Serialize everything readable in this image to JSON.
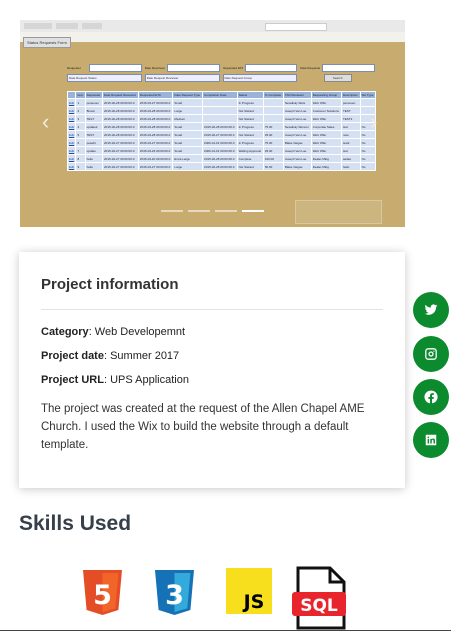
{
  "carousel": {
    "slide": {
      "app_button": "Status Requests Form",
      "filters": {
        "row1": [
          {
            "label": "Requester",
            "value": ""
          },
          {
            "label": "Date Received",
            "value": ""
          },
          {
            "label": "Requested ETA",
            "value": ""
          },
          {
            "label": "Date Requested Date",
            "value": ""
          }
        ],
        "row2": [
          {
            "label": "Date Request Status",
            "value": ""
          },
          {
            "label": "Date Request Reviewer",
            "value": ""
          },
          {
            "label": "Date Request Group",
            "value": ""
          },
          {
            "label": "",
            "value": "Search"
          }
        ]
      },
      "table": {
        "headers": [
          "",
          "Item",
          "Requester",
          "Date Request Received",
          "Requested ETA",
          "Date Request Type",
          "Completion Date",
          "Status",
          "% Complete",
          "TAN Reviewer",
          "Requesting Group",
          "Description",
          "Set Type"
        ],
        "rows": [
          [
            "Edit",
            "1",
            "perseven",
            "2015-02-28 00:00:00.0",
            "2015-03-27 00:00:00.0",
            "Small",
            "",
            "In Progress",
            "",
            "Newdisky Weis",
            "Web Offer",
            "perseven",
            ""
          ],
          [
            "Edit",
            "2",
            "Brown",
            "2015-02-28 00:00:00.0",
            "2015-03-28 00:00:00.0",
            "Large",
            "",
            "Not Started",
            "",
            "Joseph Van Lue",
            "Customer Solutions",
            "TEST",
            ""
          ],
          [
            "Edit",
            "3",
            "TEST",
            "2015-02-28 00:00:00.0",
            "2015-03-28 00:00:00.0",
            "Medium",
            "",
            "Not Started",
            "",
            "Joseph Van Lue",
            "Web Offer",
            "TEST3",
            ""
          ],
          [
            "Edit",
            "4",
            "update2",
            "2015-02-28 00:00:00.0",
            "2015-03-28 00:00:00.0",
            "Small",
            "2015-02-28 00:00:00.0",
            "In Progress",
            "75.00",
            "Newdisky Wenom",
            "Corporate Sales",
            "test",
            "No"
          ],
          [
            "Edit",
            "5",
            "TEST",
            "2015-02-28 00:00:00.0",
            "2015-03-28 00:00:00.0",
            "Small",
            "2015-02-27 00:00:00.0",
            "Not Started",
            "25.00",
            "Joseph Van Lue",
            "Web Offer",
            "note",
            "No"
          ],
          [
            "Edit",
            "6",
            "petedit",
            "2015-02-27 00:00:00.0",
            "2015-03-27 00:00:00.0",
            "Small",
            "2000-01-01 00:00:00.0",
            "In Progress",
            "75.00",
            "Blake Vargas",
            "Web Offer",
            "test2",
            "No"
          ],
          [
            "Edit",
            "7",
            "update",
            "2015-02-27 00:00:00.0",
            "2015-03-26 00:00:00.0",
            "Small",
            "2000-01-01 00:00:00.0",
            "Waiting Approval",
            "25.00",
            "Joseph Van Lue",
            "Web Offer",
            "test",
            "No"
          ],
          [
            "Edit",
            "8",
            "hello",
            "2015-02-27 00:00:00.0",
            "2015-03-20 00:00:00.0",
            "Extra Large",
            "2015-02-28 00:00:00.0",
            "Complete",
            "100.00",
            "Joseph Van Lue",
            "Dealer Mktg",
            "asdas",
            "No"
          ],
          [
            "Edit",
            "9",
            "hello",
            "2015-02-27 00:00:00.0",
            "2015-03-27 00:00:00.0",
            "Large",
            "2015-02-28 00:00:00.0",
            "Not Started",
            "50.00",
            "Blake Vargas",
            "Dealer Mktg",
            "hello",
            "No"
          ]
        ]
      }
    },
    "prev_icon": "‹",
    "next_icon": "›",
    "indicator_count": 4,
    "active_indicator": 4
  },
  "project_info": {
    "title": "Project information",
    "category_label": "Category",
    "category_value": ": Web Developemnt",
    "date_label": "Project date",
    "date_value": ": Summer 2017",
    "url_label": "Project URL",
    "url_value": ": UPS Application",
    "description": "The project was created at the request of the Allen Chapel AME Church. I used the Wix to build the website through a default template."
  },
  "social": [
    "twitter-icon",
    "instagram-icon",
    "facebook-icon",
    "linkedin-icon"
  ],
  "social_color": "#0b8a2e",
  "skills": {
    "title": "Skills Used",
    "html_text": "5",
    "css_text": "3",
    "js_text": "JS",
    "sql_text": "SQL",
    "html_color": "#e44d26",
    "css_color": "#1572b6",
    "js_color": "#f7df1e",
    "sql_color": "#e8242c"
  }
}
